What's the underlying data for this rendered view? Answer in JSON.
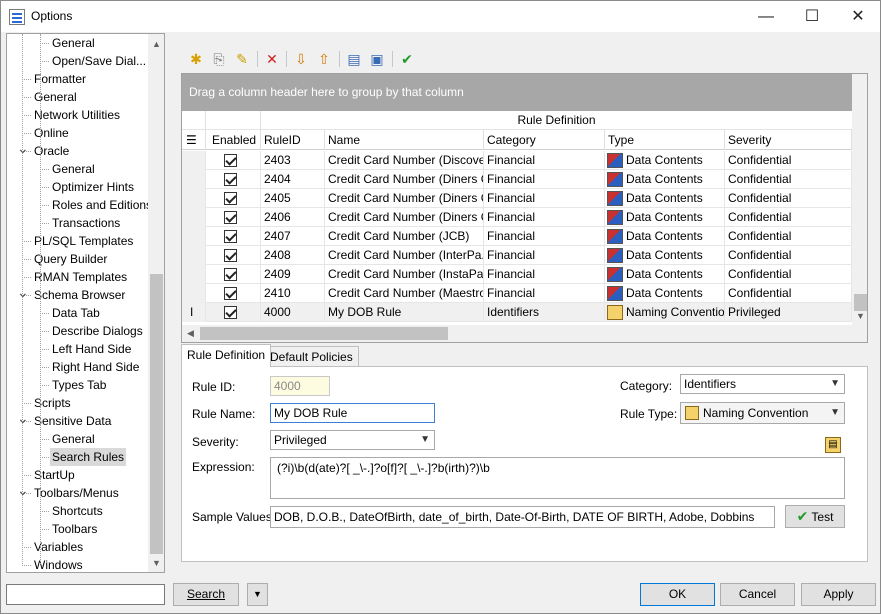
{
  "window": {
    "title": "Options",
    "minimize_label": "—",
    "maximize_label": "☐",
    "close_label": "✕"
  },
  "tree": {
    "items": [
      {
        "label": "General",
        "level": 2
      },
      {
        "label": "Open/Save Dial...",
        "level": 2
      },
      {
        "label": "Formatter",
        "level": 1
      },
      {
        "label": "General",
        "level": 1
      },
      {
        "label": "Network Utilities",
        "level": 1
      },
      {
        "label": "Online",
        "level": 1
      },
      {
        "label": "Oracle",
        "level": 1,
        "expanded": true
      },
      {
        "label": "General",
        "level": 2
      },
      {
        "label": "Optimizer Hints",
        "level": 2
      },
      {
        "label": "Roles and Editions",
        "level": 2
      },
      {
        "label": "Transactions",
        "level": 2
      },
      {
        "label": "PL/SQL Templates",
        "level": 1
      },
      {
        "label": "Query Builder",
        "level": 1
      },
      {
        "label": "RMAN Templates",
        "level": 1
      },
      {
        "label": "Schema Browser",
        "level": 1,
        "expanded": true
      },
      {
        "label": "Data Tab",
        "level": 2
      },
      {
        "label": "Describe Dialogs",
        "level": 2
      },
      {
        "label": "Left Hand Side",
        "level": 2
      },
      {
        "label": "Right Hand Side",
        "level": 2
      },
      {
        "label": "Types Tab",
        "level": 2
      },
      {
        "label": "Scripts",
        "level": 1
      },
      {
        "label": "Sensitive Data",
        "level": 1,
        "expanded": true
      },
      {
        "label": "General",
        "level": 2
      },
      {
        "label": "Search Rules",
        "level": 2,
        "selected": true
      },
      {
        "label": "StartUp",
        "level": 1
      },
      {
        "label": "Toolbars/Menus",
        "level": 1,
        "expanded": true
      },
      {
        "label": "Shortcuts",
        "level": 2
      },
      {
        "label": "Toolbars",
        "level": 2
      },
      {
        "label": "Variables",
        "level": 1
      },
      {
        "label": "Windows",
        "level": 1
      }
    ]
  },
  "toolbar": {
    "icons": [
      "new-rule-icon",
      "copy-rule-icon",
      "edit-rule-icon",
      "delete-rule-icon",
      "import-icon",
      "export-icon",
      "load-icon",
      "save-icon",
      "validate-icon"
    ]
  },
  "grid": {
    "group_hint": "Drag a column header here to group by that column",
    "band_header": "Rule Definition",
    "columns": [
      "Enabled",
      "RuleID",
      "Name",
      "Category",
      "Type",
      "Severity"
    ],
    "rows": [
      {
        "enabled": true,
        "id": "2403",
        "name": "Credit Card Number (Discover)",
        "category": "Financial",
        "type": "Data Contents",
        "severity": "Confidential"
      },
      {
        "enabled": true,
        "id": "2404",
        "name": "Credit Card Number (Diners C...",
        "category": "Financial",
        "type": "Data Contents",
        "severity": "Confidential"
      },
      {
        "enabled": true,
        "id": "2405",
        "name": "Credit Card Number (Diners C...",
        "category": "Financial",
        "type": "Data Contents",
        "severity": "Confidential"
      },
      {
        "enabled": true,
        "id": "2406",
        "name": "Credit Card Number (Diners C...",
        "category": "Financial",
        "type": "Data Contents",
        "severity": "Confidential"
      },
      {
        "enabled": true,
        "id": "2407",
        "name": "Credit Card Number (JCB)",
        "category": "Financial",
        "type": "Data Contents",
        "severity": "Confidential"
      },
      {
        "enabled": true,
        "id": "2408",
        "name": "Credit Card Number (InterPa...",
        "category": "Financial",
        "type": "Data Contents",
        "severity": "Confidential"
      },
      {
        "enabled": true,
        "id": "2409",
        "name": "Credit Card Number (InstaPa...",
        "category": "Financial",
        "type": "Data Contents",
        "severity": "Confidential"
      },
      {
        "enabled": true,
        "id": "2410",
        "name": "Credit Card Number (Maestro...",
        "category": "Financial",
        "type": "Data Contents",
        "severity": "Confidential"
      },
      {
        "enabled": true,
        "id": "4000",
        "name": "My DOB Rule",
        "category": "Identifiers",
        "type": "Naming Convention",
        "severity": "Privileged",
        "current": true
      }
    ]
  },
  "tabs": {
    "rule_definition": "Rule Definition",
    "default_policies": "Default Policies"
  },
  "form": {
    "rule_id_label": "Rule ID:",
    "rule_id_value": "4000",
    "rule_name_label": "Rule Name:",
    "rule_name_value": "My DOB Rule",
    "severity_label": "Severity:",
    "severity_value": "Privileged",
    "category_label": "Category:",
    "category_value": "Identifiers",
    "rule_type_label": "Rule Type:",
    "rule_type_value": "Naming Convention",
    "expression_label": "Expression:",
    "expression_value": "(?i)\\b(d(ate)?[ _\\-.]?o[f]?[ _\\-.]?b(irth)?)\\b",
    "sample_label": "Sample Values:",
    "sample_value": "DOB, D.O.B., DateOfBirth, date_of_birth, Date-Of-Birth, DATE OF BIRTH, Adobe, Dobbins",
    "test_label": "Test"
  },
  "footer": {
    "search_placeholder": "",
    "search_label": "Search",
    "ok_label": "OK",
    "cancel_label": "Cancel",
    "apply_label": "Apply"
  }
}
